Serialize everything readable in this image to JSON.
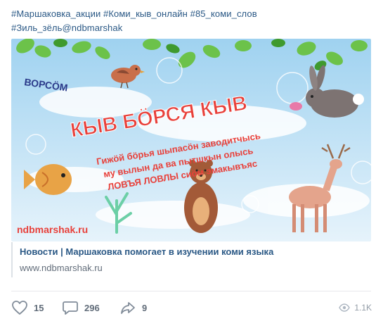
{
  "post": {
    "tags_line1": "#Маршаковка_акции #Коми_кыв_онлайн #85_коми_слов",
    "tags_line2": "#Зиль_зёль@ndbmarshak"
  },
  "image": {
    "corner_word": "ВОРСӦМ",
    "headline": "КЫВ БӦРСЯ КЫВ",
    "line1": "Гижӧй бӧрья шыпасӧн заводитчысь",
    "line2": "му вылын да ва пытшкын олысь",
    "line3": "ЛОВЪЯ ЛОВЛЫ сиӧм эмакывъяс",
    "site": "ndbmarshak.ru"
  },
  "attachment": {
    "title": "Новости | Маршаковка помогает в изучении коми языка",
    "url": "www.ndbmarshak.ru"
  },
  "actions": {
    "likes": "15",
    "comments": "296",
    "shares": "9",
    "views": "1.1K"
  },
  "colors": {
    "link": "#2a5885",
    "headline": "#e8403a",
    "sky": "#bfe3f5"
  }
}
